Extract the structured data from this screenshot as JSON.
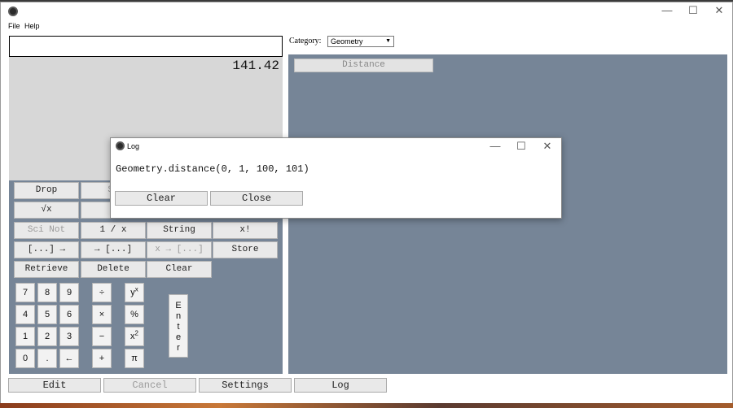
{
  "menu": {
    "file": "File",
    "help": "Help"
  },
  "window_controls": {
    "minimize": "—",
    "maximize": "☐",
    "close": "✕"
  },
  "display": {
    "value": "141.42"
  },
  "category": {
    "label": "Category:",
    "selected": "Geometry",
    "arrow": "▼"
  },
  "right_panel": {
    "distance": "Distance"
  },
  "function_buttons": {
    "drop": "Drop",
    "swap": "Sw",
    "sqrt": "√x",
    "plus_small": "+",
    "sci_not": "Sci Not",
    "reciprocal": "1 / x",
    "string": "String",
    "factorial": "x!",
    "to_list": "[...] →",
    "from_list": "→ [...]",
    "x_to_list": "x → [...]",
    "store": "Store",
    "retrieve": "Retrieve",
    "delete": "Delete",
    "clear": "Clear"
  },
  "keypad": {
    "k7": "7",
    "k8": "8",
    "k9": "9",
    "div": "÷",
    "ypow_base": "y",
    "ypow_exp": "x",
    "k4": "4",
    "k5": "5",
    "k6": "6",
    "mul": "×",
    "pct": "%",
    "k1": "1",
    "k2": "2",
    "k3": "3",
    "minus": "−",
    "sq_base": "x",
    "sq_exp": "2",
    "k0": "0",
    "dot": ".",
    "backspace": "←",
    "plus": "+",
    "pi": "π",
    "enter": [
      "E",
      "n",
      "t",
      "e",
      "r"
    ]
  },
  "bottom": {
    "edit": "Edit",
    "cancel": "Cancel",
    "settings": "Settings",
    "log": "Log"
  },
  "log_dialog": {
    "title": "Log",
    "text": "Geometry.distance(0, 1, 100, 101)",
    "clear": "Clear",
    "close": "Close"
  }
}
